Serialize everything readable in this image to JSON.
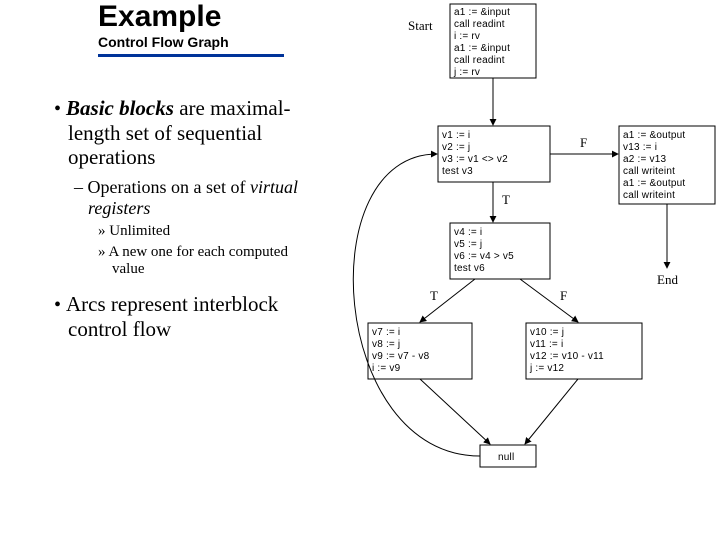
{
  "title": "Example",
  "subtitle": "Control Flow Graph",
  "bullets": {
    "b1_pre": "Basic blocks",
    "b1_rest": " are maximal-length set of sequential operations",
    "b1a": "Operations on a set of ",
    "b1a_em": "virtual registers",
    "b1a1": "Unlimited",
    "b1a2": "A new one for each computed value",
    "b2": "Arcs represent interblock control flow"
  },
  "graph": {
    "labels": {
      "start": "Start",
      "end": "End",
      "T": "T",
      "F": "F",
      "T2": "T",
      "F2": "F",
      "null": "null"
    },
    "node_start": [
      "a1 := &input",
      "call readint",
      "i := rv",
      "a1 := &input",
      "call readint",
      "j := rv"
    ],
    "node_test1": [
      "v1 := i",
      "v2 := j",
      "v3 := v1 <> v2",
      "test v3"
    ],
    "node_right": [
      "a1 := &output",
      "v13 := i",
      "a2 := v13",
      "call writeint",
      "a1 := &output",
      "call writeint"
    ],
    "node_test2": [
      "v4 := i",
      "v5 := j",
      "v6 := v4 > v5",
      "test v6"
    ],
    "node_left2": [
      "v7 := i",
      "v8 := j",
      "v9 := v7 - v8",
      "i := v9"
    ],
    "node_right2": [
      "v10 := j",
      "v11 := i",
      "v12 := v10 - v11",
      "j := v12"
    ]
  }
}
